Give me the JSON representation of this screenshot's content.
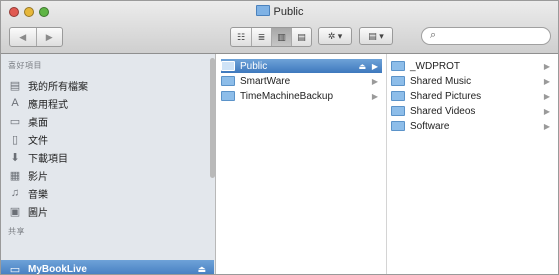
{
  "window": {
    "title": "Public"
  },
  "toolbar": {
    "back_label": "◀",
    "forward_label": "▶",
    "view_icon_grid": "☷",
    "view_icon_list": "≣",
    "view_icon_column": "▥",
    "view_icon_cover": "▤",
    "action_label": "✲ ▾",
    "arrange_label": "▤ ▾",
    "search_placeholder": ""
  },
  "sidebar": {
    "favorites_header": "喜好項目",
    "items": [
      {
        "label": "我的所有檔案",
        "icon": "all-files-icon",
        "glyph": "▤"
      },
      {
        "label": "應用程式",
        "icon": "applications-icon",
        "glyph": "A"
      },
      {
        "label": "桌面",
        "icon": "desktop-icon",
        "glyph": "▭"
      },
      {
        "label": "文件",
        "icon": "documents-icon",
        "glyph": "▯"
      },
      {
        "label": "下載項目",
        "icon": "downloads-icon",
        "glyph": "⬇"
      },
      {
        "label": "影片",
        "icon": "movies-icon",
        "glyph": "▦"
      },
      {
        "label": "音樂",
        "icon": "music-icon",
        "glyph": "♫"
      },
      {
        "label": "圖片",
        "icon": "pictures-icon",
        "glyph": "▣"
      }
    ],
    "shared_header": "共享",
    "shared_items": [
      {
        "label": "MyBookLive",
        "icon": "network-drive-icon",
        "glyph": "▭",
        "eject": "⏏"
      }
    ]
  },
  "column1": {
    "items": [
      {
        "label": "Public",
        "selected": true
      },
      {
        "label": "SmartWare",
        "selected": false
      },
      {
        "label": "TimeMachineBackup",
        "selected": false
      }
    ],
    "eject_glyph": "⏏",
    "chevron_glyph": "▶"
  },
  "column2": {
    "items": [
      {
        "label": "_WDPROT"
      },
      {
        "label": "Shared Music"
      },
      {
        "label": "Shared Pictures"
      },
      {
        "label": "Shared Videos"
      },
      {
        "label": "Software"
      }
    ],
    "chevron_glyph": "▶"
  },
  "colors": {
    "selection": "#3e78bd",
    "sidebar_bg": "#e3e7ec",
    "folder": "#8dbde9"
  }
}
